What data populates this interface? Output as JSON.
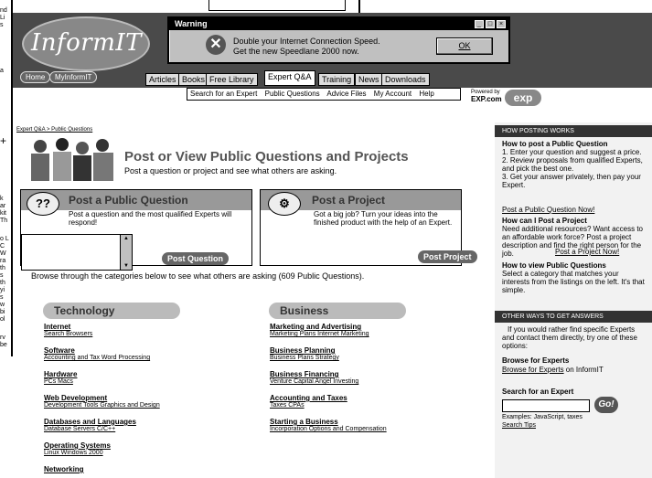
{
  "left_window": {
    "fragments": [
      "nd",
      "Li",
      "s",
      "a",
      "+",
      "k",
      "ar",
      "kit",
      "Th",
      "o L",
      "C",
      "W",
      "ra",
      "th",
      "s",
      "th",
      "yi",
      "s",
      "w",
      "bi",
      "ol",
      "rv",
      "be"
    ]
  },
  "header": {
    "logo": "InformIT",
    "home": "Home",
    "myinformit": "MyInformIT",
    "tabs": [
      "Articles",
      "Books",
      "Free Library",
      "Expert Q&A",
      "Training",
      "News",
      "Downloads"
    ],
    "active_tab": "Expert Q&A"
  },
  "dialog": {
    "title": "Warning",
    "line1": "Double your Internet Connection Speed.",
    "line2": "Get the new Speedlane 2000 now.",
    "ok_label": "OK",
    "buttons": [
      "_",
      "□",
      "×"
    ]
  },
  "subnav": [
    "Search for an Expert",
    "Public Questions",
    "Advice Files",
    "My Account",
    "Help"
  ],
  "powered": {
    "line1": "Powered by",
    "line2": "EXP.com",
    "badge": "exp"
  },
  "breadcrumb": "Expert Q&A > Public Questions",
  "page": {
    "title": "Post or View Public Questions and Projects",
    "subtitle": "Post a question or project and see what others are asking."
  },
  "post_question": {
    "title": "Post a Public Question",
    "desc": "Post a question and the most qualified Experts will respond!",
    "button": "Post Question",
    "icon": "??"
  },
  "post_project": {
    "title": "Post a Project",
    "desc": "Got a big job? Turn your ideas into the finished product with the help of an Expert.",
    "button": "Post Project",
    "icon": "⚙"
  },
  "browse_text": "Browse through the categories below to see what others are asking (609 Public Questions).",
  "categories": {
    "technology": {
      "heading": "Technology",
      "items": [
        {
          "title": "Internet",
          "sub": "Search Browsers"
        },
        {
          "title": "Software",
          "sub": "Accounting and Tax Word Processing"
        },
        {
          "title": "Hardware",
          "sub": "PCs Macs"
        },
        {
          "title": "Web Development",
          "sub": "Development Tools Graphics and Design"
        },
        {
          "title": "Databases and Languages",
          "sub": "Database Servers C/C++"
        },
        {
          "title": "Operating Systems",
          "sub": "Linux Windows 2000"
        },
        {
          "title": "Networking",
          "sub": ""
        }
      ]
    },
    "business": {
      "heading": "Business",
      "items": [
        {
          "title": "Marketing and Advertising",
          "sub": "Marketing Plans Internet Marketing"
        },
        {
          "title": "Business Planning",
          "sub": "Business Plans Strategy"
        },
        {
          "title": "Business Financing",
          "sub": "Venture Capital Angel Investing"
        },
        {
          "title": "Accounting and Taxes",
          "sub": "Taxes CPAs"
        },
        {
          "title": "Starting a Business",
          "sub": "Incorporation Options and Compensation"
        }
      ]
    }
  },
  "sidebar": {
    "how_header": "HOW POSTING WORKS",
    "q1": "How to post a Public Question",
    "t1": "1. Enter your question and suggest a price.\n2. Review proposals from qualified Experts, and pick the best one.\n3. Get your answer privately, then pay your Expert.",
    "l1": "Post a Public Question Now!",
    "q2": "How can I Post a Project",
    "t2": "Need additional resources? Want access to an affordable work force? Post a project description and find the right person for the job.",
    "l2": "Post a Project Now!",
    "q3": "How to view Public Questions",
    "t3": "Select a category that matches your interests from the listings on the left. It's that simple.",
    "other_header": "OTHER WAYS TO GET ANSWERS",
    "t4": "If you would rather find specific Experts and contact them directly, try one of these options:",
    "q4": "Browse for Experts",
    "l4": "Browse for Experts",
    "t4b": " on InformIT",
    "q5": "Search for an Expert",
    "go": "Go!",
    "examples": "Examples: JavaScript, taxes",
    "tips": "Search Tips"
  }
}
